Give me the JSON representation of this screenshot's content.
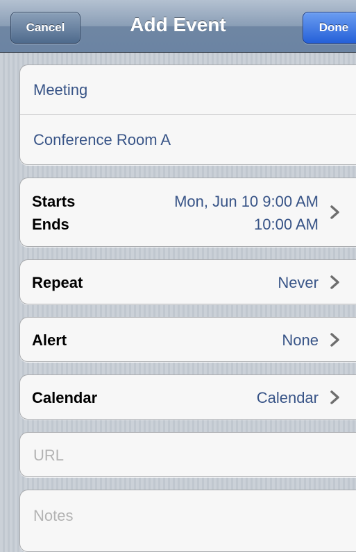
{
  "nav": {
    "title": "Add Event",
    "cancel_label": "Cancel",
    "done_label": "Done"
  },
  "event": {
    "title": "Meeting",
    "location": "Conference Room A"
  },
  "time": {
    "starts_label": "Starts",
    "ends_label": "Ends",
    "starts_value": "Mon, Jun 10  9:00 AM",
    "ends_value": "10:00 AM"
  },
  "repeat": {
    "label": "Repeat",
    "value": "Never"
  },
  "alert": {
    "label": "Alert",
    "value": "None"
  },
  "calendar": {
    "label": "Calendar",
    "value": "Calendar"
  },
  "url": {
    "placeholder": "URL"
  },
  "notes": {
    "placeholder": "Notes"
  },
  "colors": {
    "nav_bar": "#6b84a3",
    "done_button": "#2560d8",
    "value_text": "#385487",
    "background": "#c5ccd4"
  },
  "icons": {
    "disclosure": "chevron-right-icon"
  }
}
